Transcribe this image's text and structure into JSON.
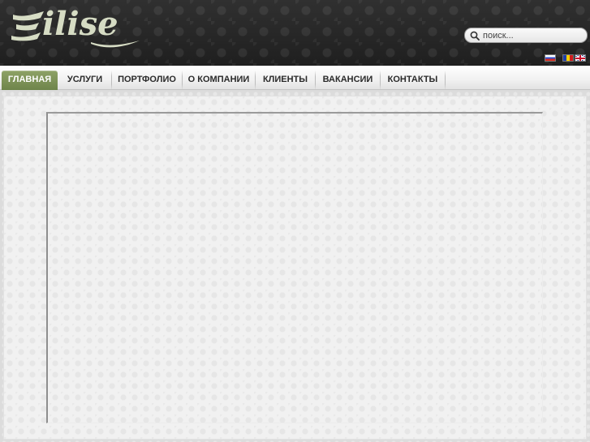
{
  "header": {
    "logo_text": "ilise",
    "search": {
      "placeholder": "поиск..."
    },
    "languages": [
      {
        "code": "ru",
        "icon": "flag-russia-icon"
      },
      {
        "code": "ro",
        "icon": "flag-romania-icon"
      },
      {
        "code": "en",
        "icon": "flag-uk-icon"
      }
    ]
  },
  "nav": {
    "items": [
      {
        "label": "ГЛАВНАЯ",
        "active": true
      },
      {
        "label": "УСЛУГИ",
        "active": false
      },
      {
        "label": "ПОРТФОЛИО",
        "active": false
      },
      {
        "label": "О КОМПАНИИ",
        "active": false
      },
      {
        "label": "КЛИЕНТЫ",
        "active": false
      },
      {
        "label": "ВАКАНСИИ",
        "active": false
      },
      {
        "label": "КОНТАКТЫ",
        "active": false
      }
    ]
  },
  "colors": {
    "accent": "#7a8f55",
    "header_bg": "#2a2a2a",
    "logo": "#d6dcc4"
  }
}
